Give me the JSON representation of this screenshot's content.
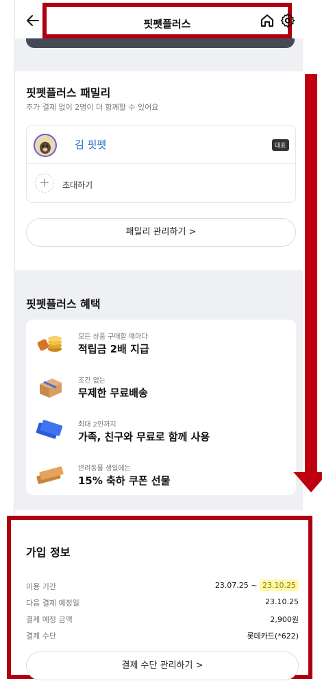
{
  "header": {
    "title": "핏펫플러스"
  },
  "family": {
    "title": "핏펫플러스 패밀리",
    "subtitle": "추가 결제 없이 2명이 더 함께할 수 있어요",
    "member_name": "김 핏펫",
    "member_badge": "대표",
    "invite_label": "초대하기",
    "manage_button": "패밀리 관리하기 >"
  },
  "benefits": {
    "title": "핏펫플러스 혜택",
    "items": [
      {
        "small": "모든 상품 구매할 때마다",
        "main": "적립금 2배 지급",
        "icon": "coins-icon"
      },
      {
        "small": "조건 없는",
        "main": "무제한 무료배송",
        "icon": "parcel-icon"
      },
      {
        "small": "최대 2인까지",
        "main": "가족, 친구와 무료로 함께 사용",
        "icon": "member-cards-icon"
      },
      {
        "small": "반려동물 생일에는",
        "main": "15% 축하 쿠폰 선물",
        "icon": "coupon-icon"
      }
    ]
  },
  "signup": {
    "title": "가입 정보",
    "period_label": "이용 기간",
    "period_start": "23.07.25 ~",
    "period_end": "23.10.25",
    "next_payment_label": "다음 결제 예정일",
    "next_payment_value": "23.10.25",
    "amount_label": "결제 예정 금액",
    "amount_value": "2,900원",
    "method_label": "결제 수단",
    "method_value": "롯데카드(*622)",
    "manage_button": "결제 수단 관리하기 >"
  },
  "colors": {
    "annotation_red": "#b00010",
    "link_blue": "#1a65c9",
    "highlight_yellow": "#fff9a8"
  }
}
